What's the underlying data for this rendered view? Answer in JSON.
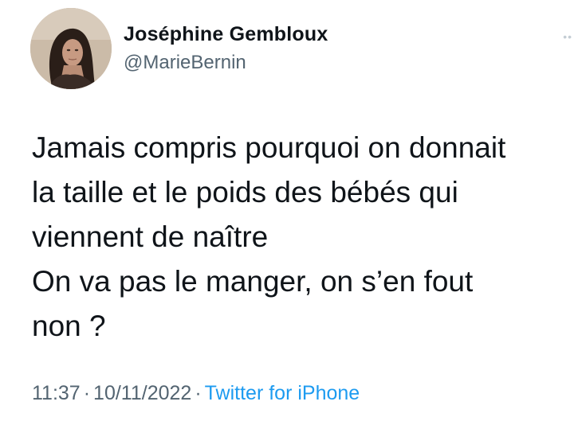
{
  "author": {
    "display_name": "Joséphine Gembloux",
    "handle": "@MarieBernin"
  },
  "tweet": {
    "lines": [
      "Jamais compris pourquoi on donnait",
      "la taille et le poids des bébés qui",
      "viennent de naître",
      "On va pas le manger, on s’en fout",
      "non ?"
    ]
  },
  "meta": {
    "time": "11:37",
    "date": "10/11/2022",
    "separator": "·",
    "source": "Twitter for iPhone"
  },
  "colors": {
    "text": "#0f1419",
    "secondary": "#536471",
    "link": "#1d9bf0"
  },
  "icons": {
    "more": "more-dots-icon"
  }
}
